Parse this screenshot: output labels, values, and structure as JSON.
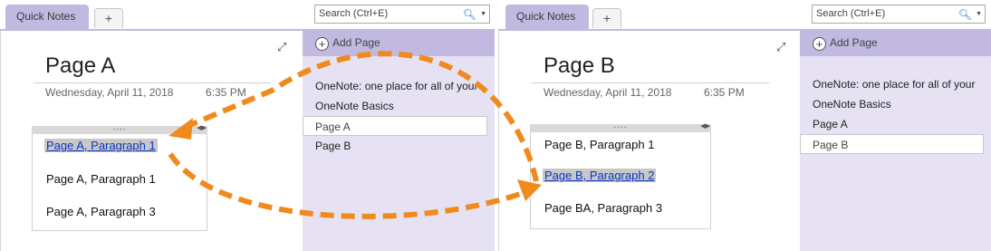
{
  "windows": [
    {
      "id": "a",
      "section_tab": "Quick Notes",
      "new_tab_label": "+",
      "search": {
        "placeholder": "Search (Ctrl+E)"
      },
      "add_page_label": "Add Page",
      "page": {
        "title": "Page A",
        "date": "Wednesday, April 11, 2018",
        "time": "6:35 PM",
        "paragraphs": [
          "Page A, Paragraph 1",
          "Page A, Paragraph 1",
          "Page A, Paragraph 3"
        ]
      },
      "page_list": [
        "OneNote: one place for all of your",
        "OneNote Basics",
        "Page A",
        "Page B"
      ]
    },
    {
      "id": "b",
      "section_tab": "Quick Notes",
      "new_tab_label": "+",
      "search": {
        "placeholder": "Search (Ctrl+E)"
      },
      "add_page_label": "Add Page",
      "page": {
        "title": "Page B",
        "date": "Wednesday, April 11, 2018",
        "time": "6:35 PM",
        "paragraphs": [
          "Page B, Paragraph 1",
          "Page B, Paragraph 2",
          "Page BA, Paragraph 3"
        ]
      },
      "page_list": [
        "OneNote: one place for all of your",
        "OneNote Basics",
        "Page A",
        "Page B"
      ]
    }
  ],
  "icons": {
    "expand": "expand-diagonal-icon",
    "search": "magnifier-icon",
    "dropdown": "caret-down-icon",
    "add_page": "plus-circle-icon",
    "note_grip": "drag-grip-icon",
    "note_resize": "resize-arrows-icon"
  },
  "colors": {
    "tab_purple": "#c1b9e0",
    "sidebar_lavender": "#e6e2f3",
    "selection_gray": "#c8c8c8",
    "link_blue": "#0b36c0",
    "arrow_orange": "#f08a1d"
  }
}
